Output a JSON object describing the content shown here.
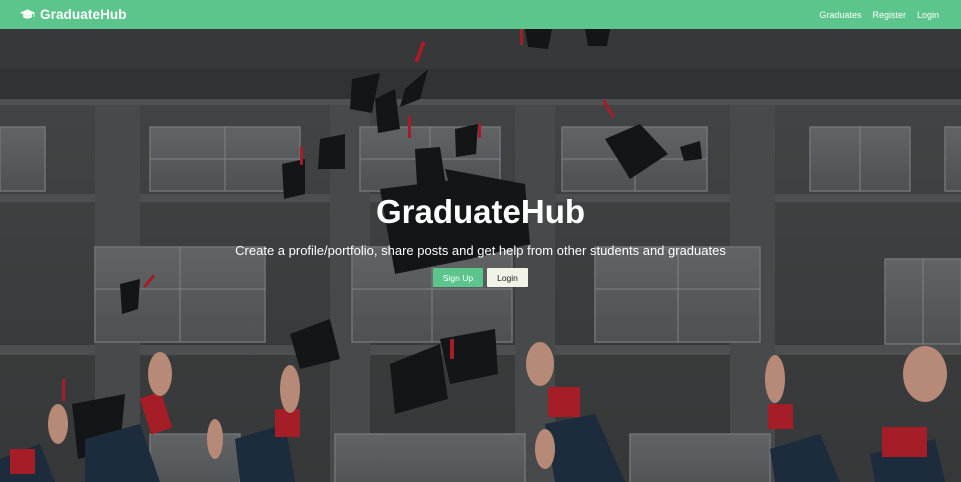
{
  "navbar": {
    "brand": "GraduateHub",
    "brand_icon": "graduation-cap-icon",
    "links": [
      "Graduates",
      "Register",
      "Login"
    ],
    "background": "#5bc58b"
  },
  "hero": {
    "title": "GraduateHub",
    "lead": "Create a profile/portfolio, share posts and get help from other students and graduates",
    "signup_label": "Sign Up",
    "login_label": "Login",
    "background_image": "graduates-throwing-caps-photo"
  },
  "colors": {
    "accent": "#5bc58b",
    "light_button": "#f1f3e6"
  }
}
